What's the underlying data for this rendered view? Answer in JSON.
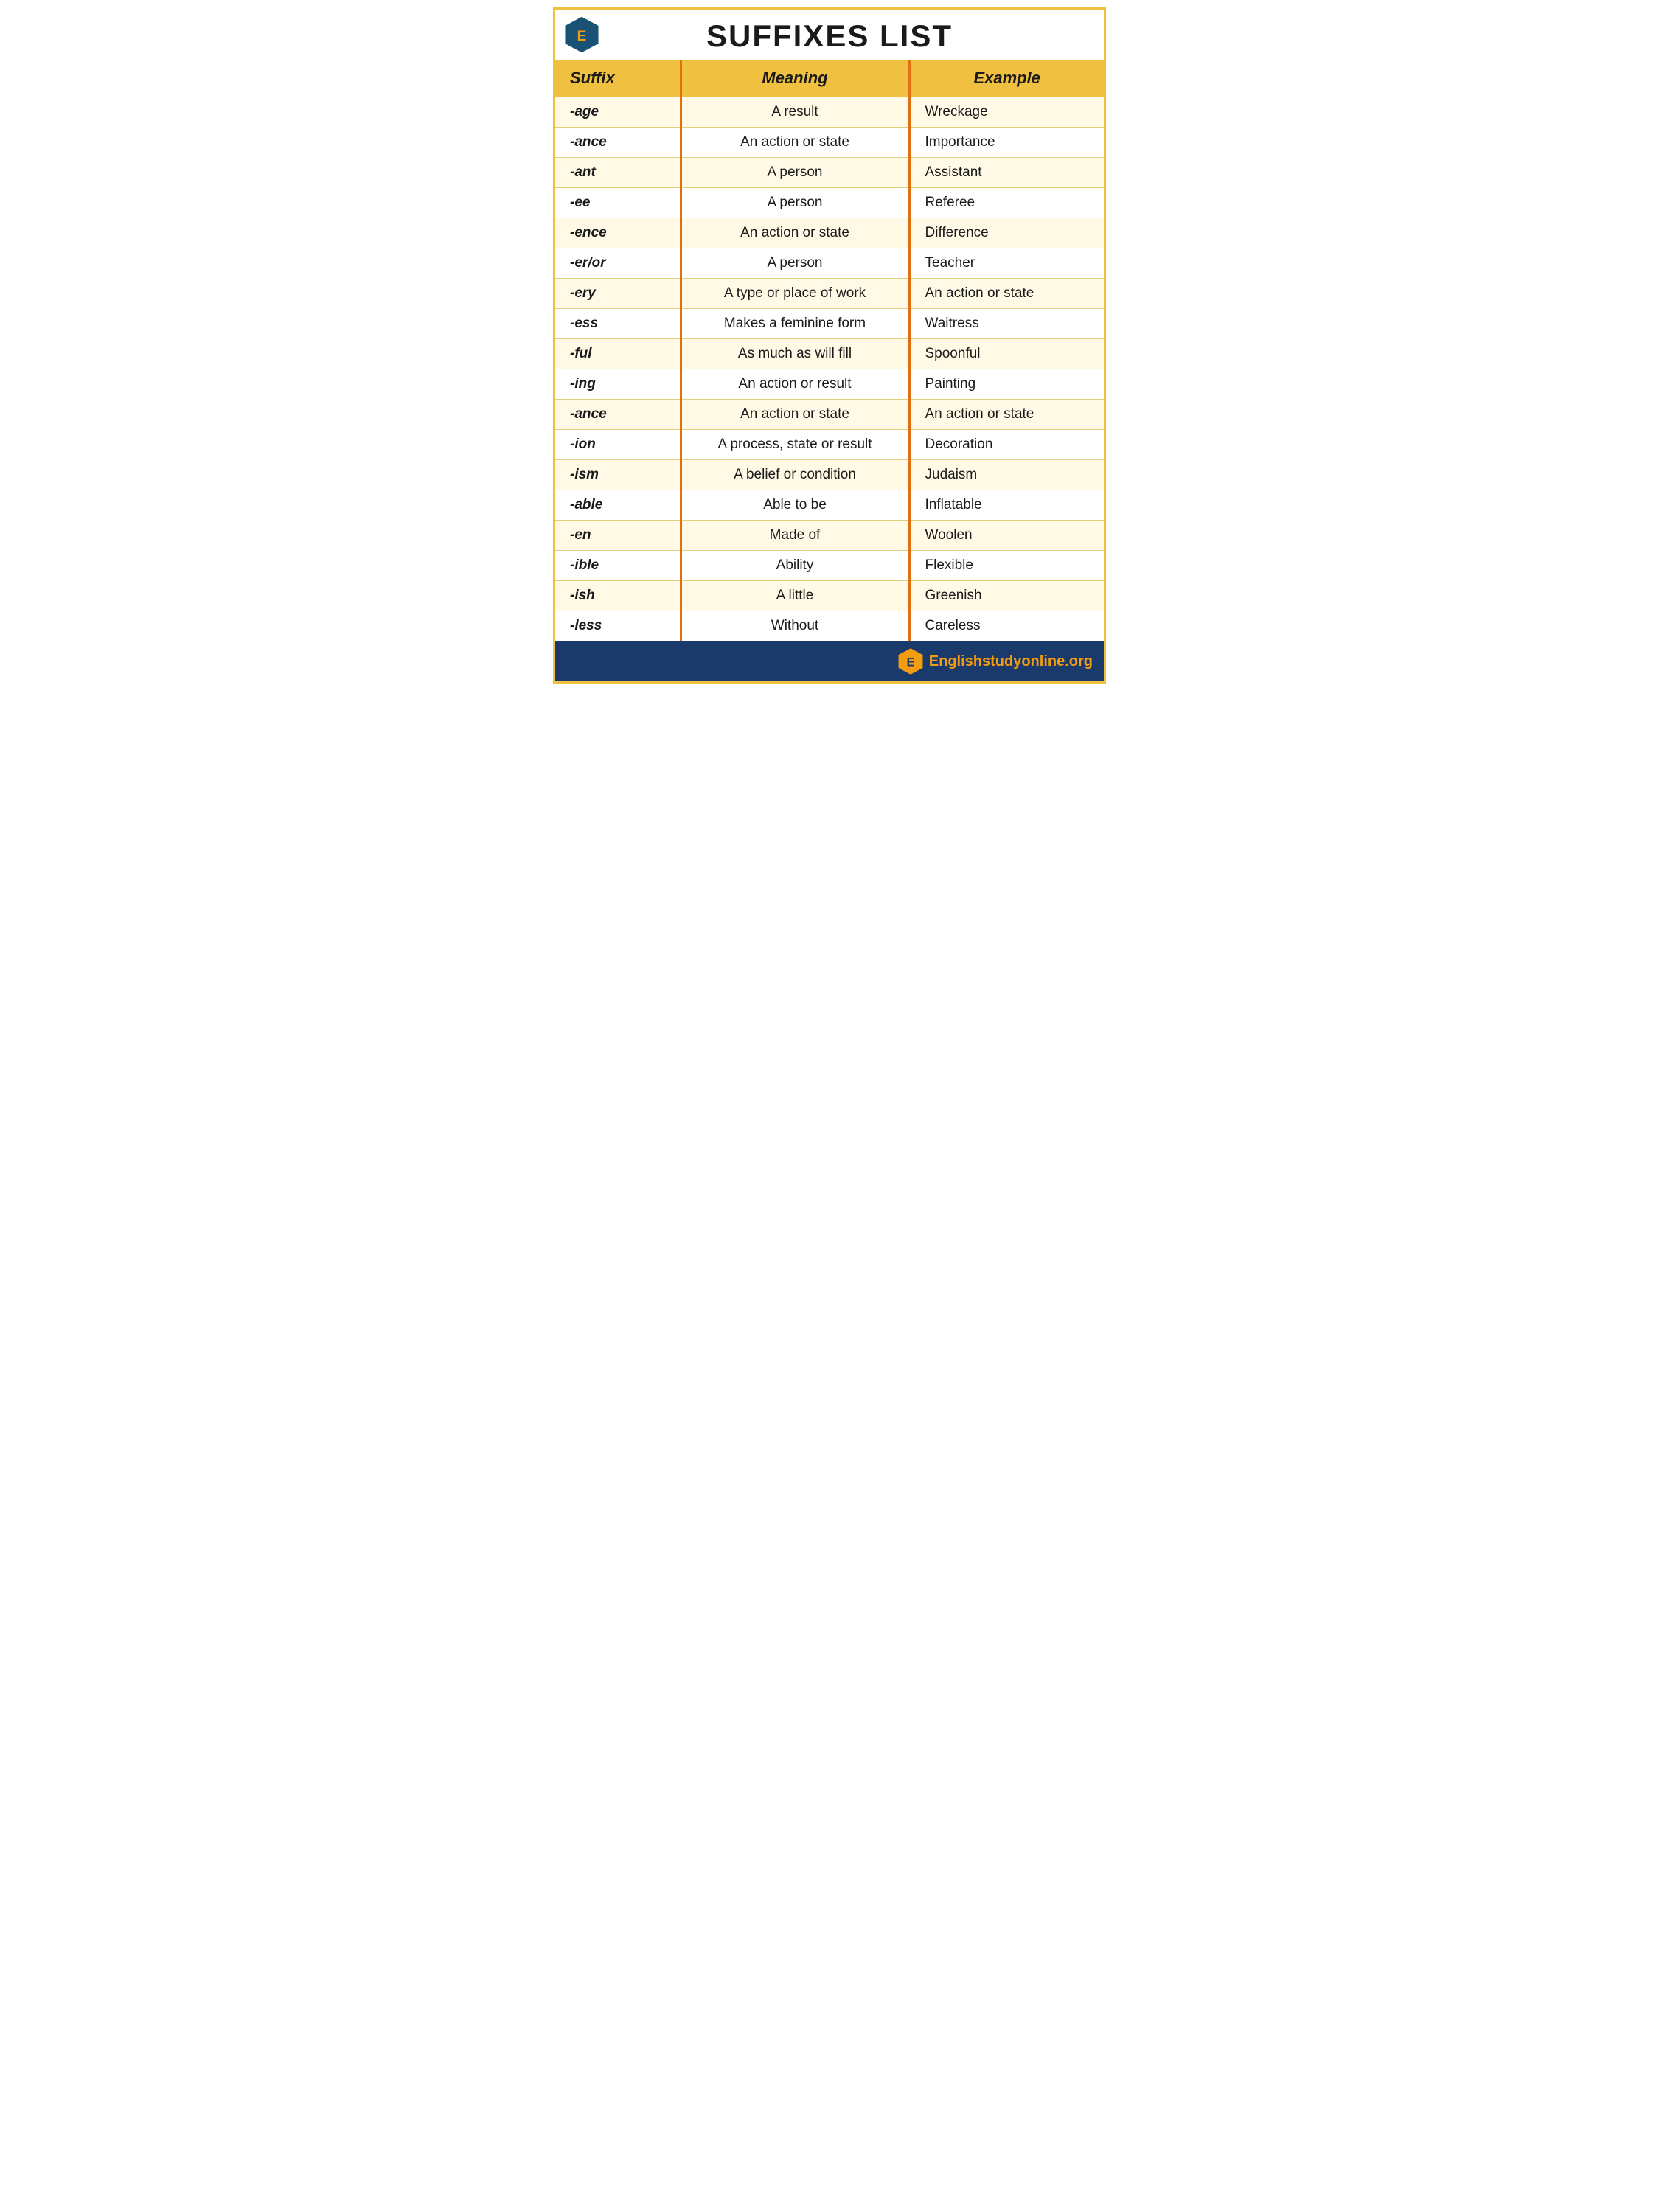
{
  "page": {
    "title": "SUFFIXES LIST",
    "logo_letter": "E",
    "footer_text_plain": "nglishstudyonline.org",
    "footer_text_bold": "E"
  },
  "table": {
    "headers": [
      "Suffix",
      "Meaning",
      "Example"
    ],
    "rows": [
      {
        "suffix": "-age",
        "meaning": "A result",
        "example": "Wreckage",
        "bg": "light"
      },
      {
        "suffix": "-ance",
        "meaning": "An action or state",
        "example": "Importance",
        "bg": "lighter"
      },
      {
        "suffix": "-ant",
        "meaning": "A person",
        "example": "Assistant",
        "bg": "light"
      },
      {
        "suffix": "-ee",
        "meaning": "A person",
        "example": "Referee",
        "bg": "lighter"
      },
      {
        "suffix": "-ence",
        "meaning": "An action or state",
        "example": "Difference",
        "bg": "light"
      },
      {
        "suffix": "-er/or",
        "meaning": "A person",
        "example": "Teacher",
        "bg": "lighter"
      },
      {
        "suffix": "-ery",
        "meaning": "A type or place of work",
        "example": "An action or state",
        "bg": "light"
      },
      {
        "suffix": "-ess",
        "meaning": "Makes a feminine form",
        "example": "Waitress",
        "bg": "lighter"
      },
      {
        "suffix": "-ful",
        "meaning": "As much as will fill",
        "example": "Spoonful",
        "bg": "light"
      },
      {
        "suffix": "-ing",
        "meaning": "An action or result",
        "example": "Painting",
        "bg": "lighter"
      },
      {
        "suffix": "-ance",
        "meaning": "An action or state",
        "example": "An action or state",
        "bg": "light"
      },
      {
        "suffix": "-ion",
        "meaning": "A process, state or result",
        "example": "Decoration",
        "bg": "lighter"
      },
      {
        "suffix": "-ism",
        "meaning": "A belief or condition",
        "example": "Judaism",
        "bg": "light"
      },
      {
        "suffix": "-able",
        "meaning": "Able to be",
        "example": "Inflatable",
        "bg": "lighter"
      },
      {
        "suffix": "-en",
        "meaning": "Made of",
        "example": "Woolen",
        "bg": "light"
      },
      {
        "suffix": "-ible",
        "meaning": "Ability",
        "example": "Flexible",
        "bg": "lighter"
      },
      {
        "suffix": "-ish",
        "meaning": "A little",
        "example": "Greenish",
        "bg": "light"
      },
      {
        "suffix": "-less",
        "meaning": "Without",
        "example": "Careless",
        "bg": "lighter"
      }
    ]
  }
}
